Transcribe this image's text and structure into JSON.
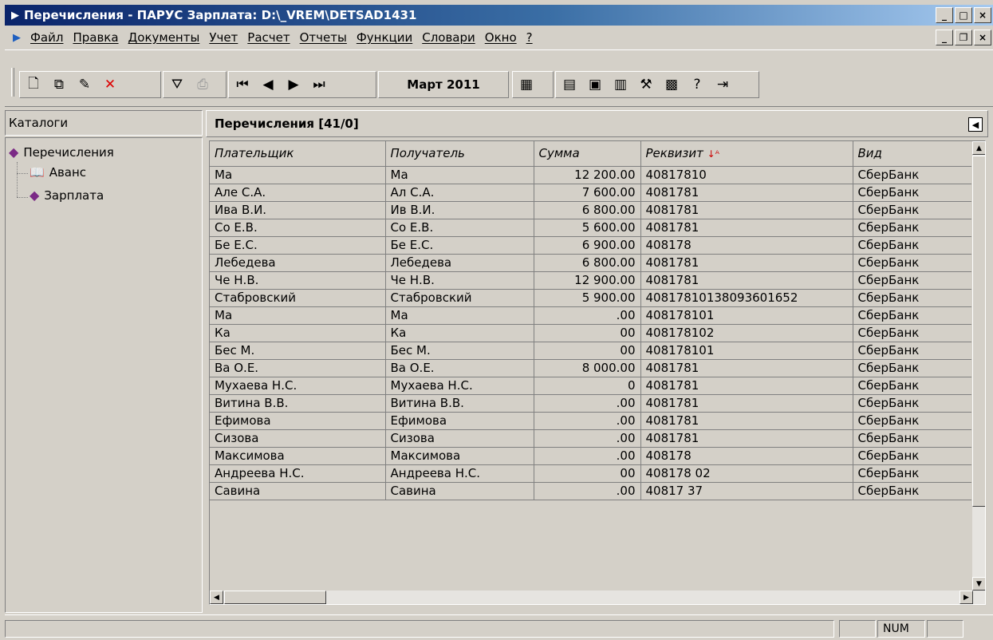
{
  "window": {
    "title": "Перечисления - ПАРУС Зарплата: D:\\_VREM\\DETSAD1431"
  },
  "menu": [
    "Файл",
    "Правка",
    "Документы",
    "Учет",
    "Расчет",
    "Отчеты",
    "Функции",
    "Словари",
    "Окно",
    "?"
  ],
  "toolbar": {
    "period": "Март 2011"
  },
  "left": {
    "header": "Каталоги",
    "tree": {
      "root": "Перечисления",
      "children": [
        "Аванс",
        "Зарплата"
      ]
    }
  },
  "right": {
    "header": "Перечисления [41/0]"
  },
  "table": {
    "columns": [
      "Плательщик",
      "Получатель",
      "Сумма",
      "Реквизит",
      "Вид"
    ],
    "rows": [
      [
        "Ма",
        "Ма",
        "12 200.00",
        "40817810",
        "СберБанк"
      ],
      [
        "Але С.А.",
        "Ал С.А.",
        "7 600.00",
        "4081781",
        "СберБанк"
      ],
      [
        "Ива В.И.",
        "Ив В.И.",
        "6 800.00",
        "4081781",
        "СберБанк"
      ],
      [
        "Со Е.В.",
        "Со Е.В.",
        "5 600.00",
        "4081781",
        "СберБанк"
      ],
      [
        "Бе Е.С.",
        "Бе Е.С.",
        "6 900.00",
        "408178",
        "СберБанк"
      ],
      [
        "Лебедева",
        "Лебедева",
        "6 800.00",
        "4081781",
        "СберБанк"
      ],
      [
        "Че Н.В.",
        "Че Н.В.",
        "12 900.00",
        "4081781",
        "СберБанк"
      ],
      [
        "Стабровский",
        "Стабровский",
        "5 900.00",
        "40817810138093601652",
        "СберБанк"
      ],
      [
        "Ма",
        "Ма",
        ".00",
        "408178101",
        "СберБанк"
      ],
      [
        "Ка",
        "Ка",
        "00",
        "408178102",
        "СберБанк"
      ],
      [
        "Бес М.",
        "Бес М.",
        "00",
        "408178101",
        "СберБанк"
      ],
      [
        "Ва О.Е.",
        "Ва О.Е.",
        "8 000.00",
        "4081781",
        "СберБанк"
      ],
      [
        "Мухаева Н.С.",
        "Мухаева Н.С.",
        "0",
        "4081781",
        "СберБанк"
      ],
      [
        "Витина В.В.",
        "Витина В.В.",
        ".00",
        "4081781",
        "СберБанк"
      ],
      [
        "Ефимова",
        "Ефимова",
        ".00",
        "4081781",
        "СберБанк"
      ],
      [
        "Сизова",
        "Сизова",
        ".00",
        "4081781",
        "СберБанк"
      ],
      [
        "Максимова",
        "Максимова",
        ".00",
        "408178",
        "СберБанк"
      ],
      [
        "Андреева Н.С.",
        "Андреева Н.С.",
        "00",
        "408178 02",
        "СберБанк"
      ],
      [
        "Савина",
        "Савина",
        ".00",
        "40817 37",
        "СберБанк"
      ]
    ]
  },
  "status": {
    "num": "NUM"
  }
}
